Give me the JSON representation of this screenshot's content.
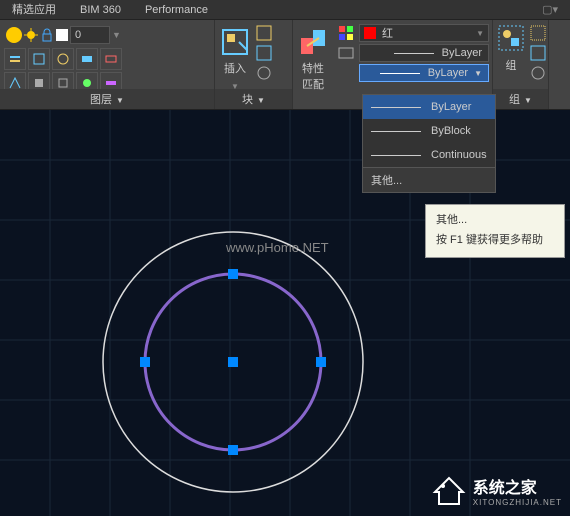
{
  "tabs": {
    "featured": "精选应用",
    "bim360": "BIM 360",
    "performance": "Performance"
  },
  "panels": {
    "layer": {
      "title": "图层",
      "value": "0"
    },
    "block": {
      "title": "块",
      "insert": "插入"
    },
    "properties": {
      "title": "特性",
      "match": "特性\n匹配",
      "color": "红",
      "lineweight": "ByLayer",
      "linetype": "ByLayer"
    },
    "group": {
      "title": "组",
      "label": "组"
    }
  },
  "dropdown": {
    "items": [
      "ByLayer",
      "ByBlock",
      "Continuous"
    ],
    "other": "其他..."
  },
  "tooltip": {
    "line1": "其他...",
    "line2": "按 F1 键获得更多帮助"
  },
  "watermark": "www.pHome.NET",
  "logo": {
    "text": "系统之家",
    "sub": "XITONGZHIJIA.NET"
  }
}
